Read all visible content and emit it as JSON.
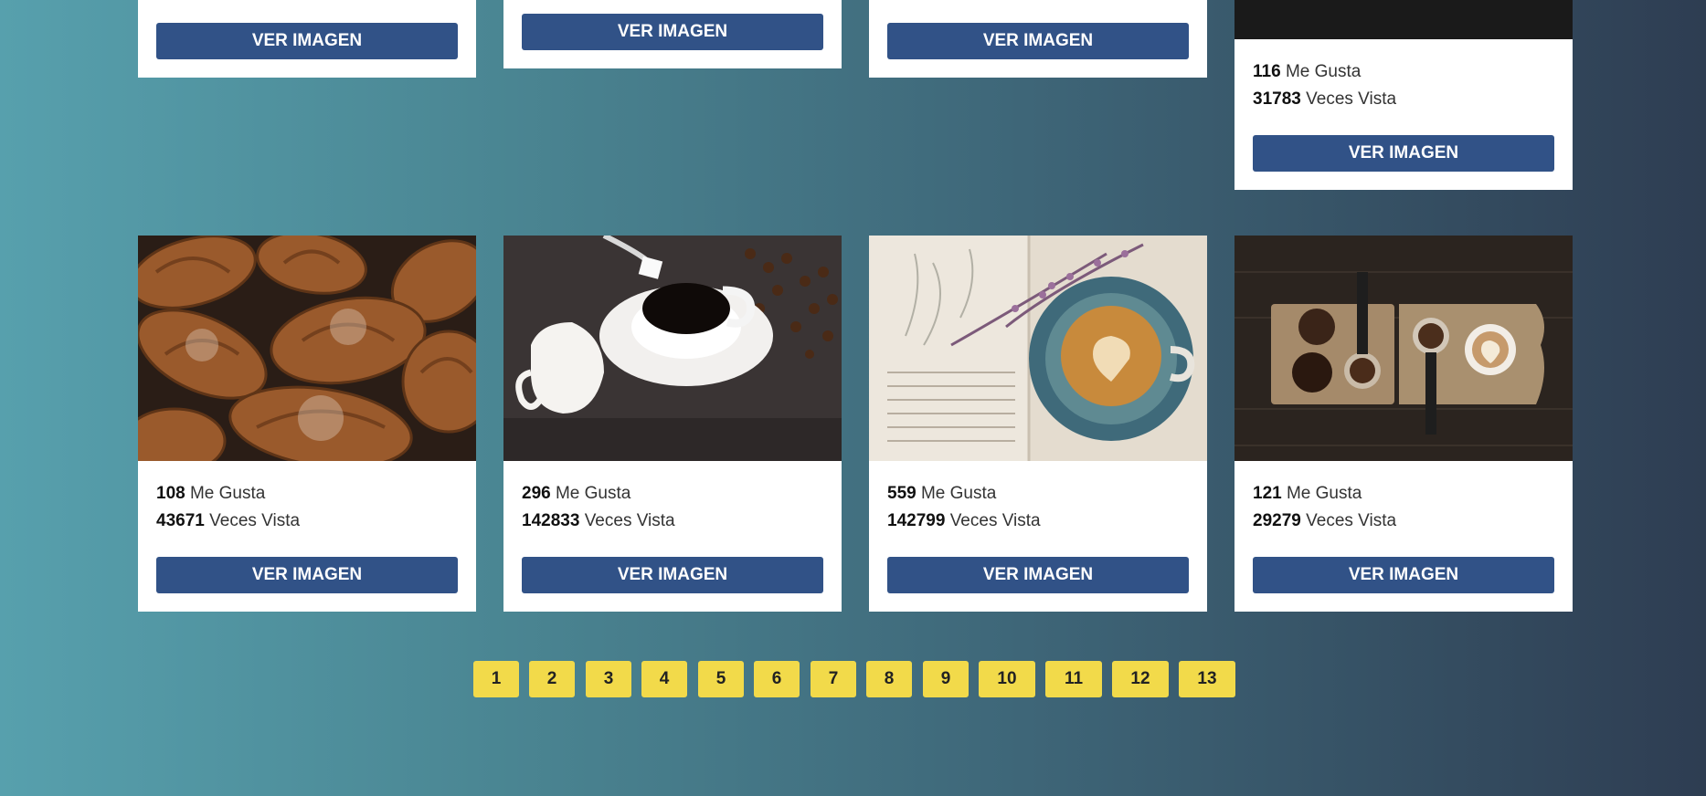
{
  "button_label": "VER IMAGEN",
  "likes_label": "Me Gusta",
  "views_label": "Veces Vista",
  "top_cards": [
    {
      "likes": "116",
      "views": "31783"
    }
  ],
  "cards": [
    {
      "image": "croissants-photo",
      "likes": "108",
      "views": "43671"
    },
    {
      "image": "coffee-cup-sugar-photo",
      "likes": "296",
      "views": "142833"
    },
    {
      "image": "latte-on-book-photo",
      "likes": "559",
      "views": "142799"
    },
    {
      "image": "coffee-tools-board-photo",
      "likes": "121",
      "views": "29279"
    }
  ],
  "pagination": [
    "1",
    "2",
    "3",
    "4",
    "5",
    "6",
    "7",
    "8",
    "9",
    "10",
    "11",
    "12",
    "13"
  ],
  "colors": {
    "button": "#315287",
    "page_button": "#f2da4a",
    "background_left": "#57a0ad",
    "background_right": "#2e3d52"
  }
}
